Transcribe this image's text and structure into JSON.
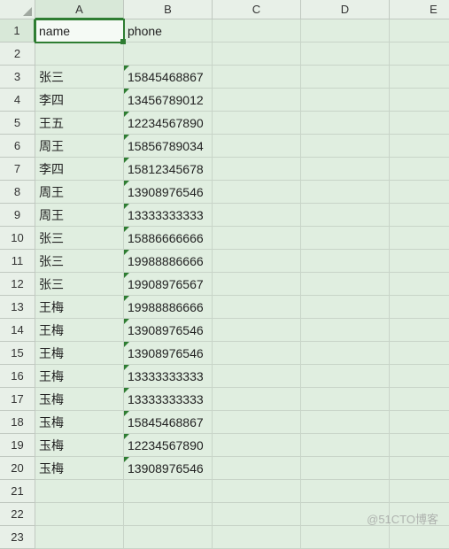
{
  "columns": [
    "A",
    "B",
    "C",
    "D",
    "E"
  ],
  "selected_cell": {
    "row": 1,
    "col": "A"
  },
  "headers": {
    "A": "name",
    "B": "phone"
  },
  "rows": [
    {
      "n": 1,
      "A": "name",
      "B": "phone"
    },
    {
      "n": 2,
      "A": "",
      "B": ""
    },
    {
      "n": 3,
      "A": "张三",
      "B": "15845468867"
    },
    {
      "n": 4,
      "A": "李四",
      "B": "13456789012"
    },
    {
      "n": 5,
      "A": "王五",
      "B": "12234567890"
    },
    {
      "n": 6,
      "A": "周王",
      "B": "15856789034"
    },
    {
      "n": 7,
      "A": "李四",
      "B": "15812345678"
    },
    {
      "n": 8,
      "A": "周王",
      "B": "13908976546"
    },
    {
      "n": 9,
      "A": "周王",
      "B": "13333333333"
    },
    {
      "n": 10,
      "A": "张三",
      "B": "15886666666"
    },
    {
      "n": 11,
      "A": "张三",
      "B": "19988886666"
    },
    {
      "n": 12,
      "A": "张三",
      "B": "19908976567"
    },
    {
      "n": 13,
      "A": "王梅",
      "B": "19988886666"
    },
    {
      "n": 14,
      "A": "王梅",
      "B": "13908976546"
    },
    {
      "n": 15,
      "A": "王梅",
      "B": "13908976546"
    },
    {
      "n": 16,
      "A": "王梅",
      "B": "13333333333"
    },
    {
      "n": 17,
      "A": "玉梅",
      "B": "13333333333"
    },
    {
      "n": 18,
      "A": "玉梅",
      "B": "15845468867"
    },
    {
      "n": 19,
      "A": "玉梅",
      "B": "12234567890"
    },
    {
      "n": 20,
      "A": "玉梅",
      "B": "13908976546"
    },
    {
      "n": 21,
      "A": "",
      "B": ""
    },
    {
      "n": 22,
      "A": "",
      "B": ""
    },
    {
      "n": 23,
      "A": "",
      "B": ""
    }
  ],
  "watermark": "@51CTO博客"
}
